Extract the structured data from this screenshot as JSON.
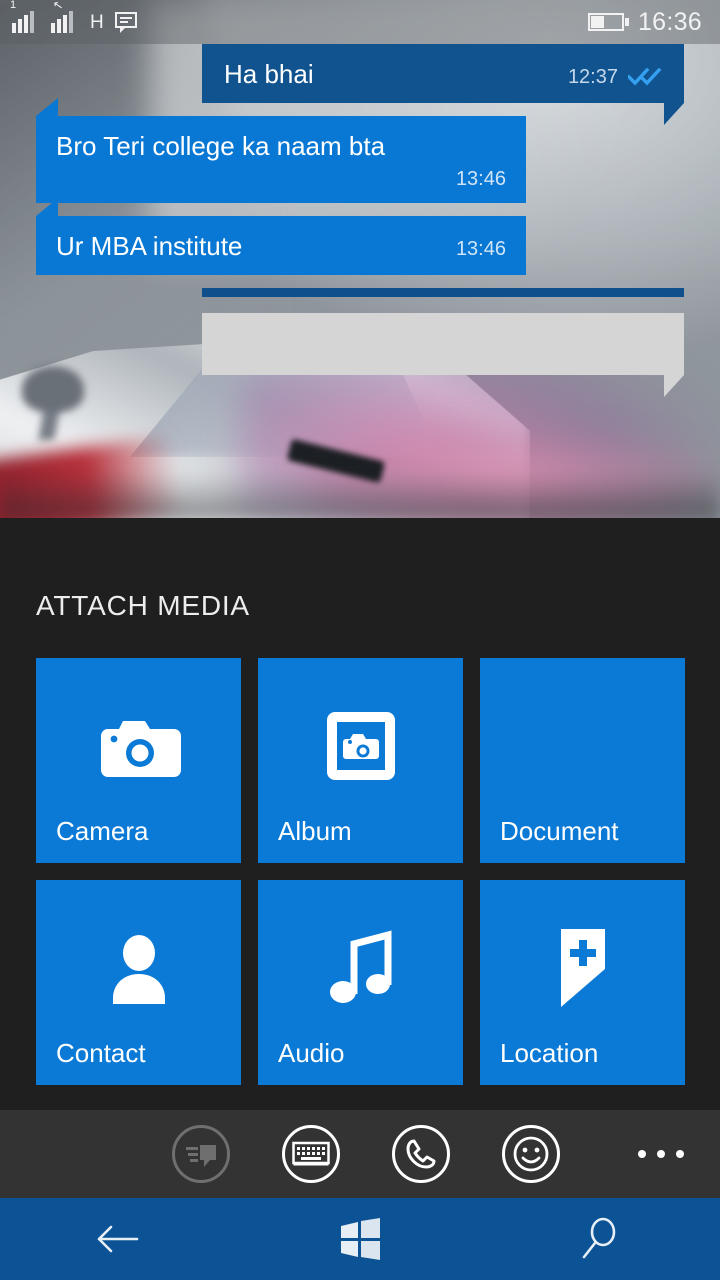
{
  "statusbar": {
    "sim1_badge": "1",
    "sim2_icon": "signal-bars-icon",
    "network_type": "H",
    "message_icon": "sms-icon",
    "battery_icon": "battery-half-icon",
    "time": "16:36"
  },
  "chat": {
    "messages": [
      {
        "text": "Ha bhai",
        "time": "12:37",
        "direction": "out",
        "status_icon": "double-check-icon",
        "layout": "inline"
      },
      {
        "text": "Bro Teri college ka naam bta",
        "time": "13:46",
        "direction": "in",
        "status_icon": "",
        "layout": "stacked"
      },
      {
        "text": "Ur MBA institute",
        "time": "13:46",
        "direction": "in",
        "status_icon": "",
        "layout": "inline"
      }
    ],
    "placeholder_bubble": {
      "text": "",
      "direction": "out"
    }
  },
  "attach_panel": {
    "title": "ATTACH MEDIA",
    "tiles": [
      {
        "label": "Camera",
        "icon": "camera-icon"
      },
      {
        "label": "Album",
        "icon": "photo-album-icon"
      },
      {
        "label": "Document",
        "icon": ""
      },
      {
        "label": "Contact",
        "icon": "person-icon"
      },
      {
        "label": "Audio",
        "icon": "music-note-icon"
      },
      {
        "label": "Location",
        "icon": "location-pin-plus-icon"
      }
    ]
  },
  "appbar": {
    "buttons": [
      {
        "name": "attach-media-button",
        "icon": "attach-message-icon",
        "state": "selected"
      },
      {
        "name": "keyboard-button",
        "icon": "keyboard-icon",
        "state": "normal"
      },
      {
        "name": "call-button",
        "icon": "phone-icon",
        "state": "normal"
      },
      {
        "name": "emoji-button",
        "icon": "smiley-icon",
        "state": "normal"
      }
    ],
    "overflow_icon": "ellipsis-icon"
  },
  "navbar": {
    "back_icon": "back-arrow-icon",
    "start_icon": "windows-logo-icon",
    "search_icon": "search-icon"
  },
  "colors": {
    "outgoing_bubble": "#10538f",
    "incoming_bubble": "#0978d4",
    "tile": "#0b7ad6",
    "panel_bg": "#1f1f1f",
    "appbar_bg": "#333333",
    "navbar_bg": "#0b5394",
    "placeholder_bubble": "#d5d5d5"
  }
}
